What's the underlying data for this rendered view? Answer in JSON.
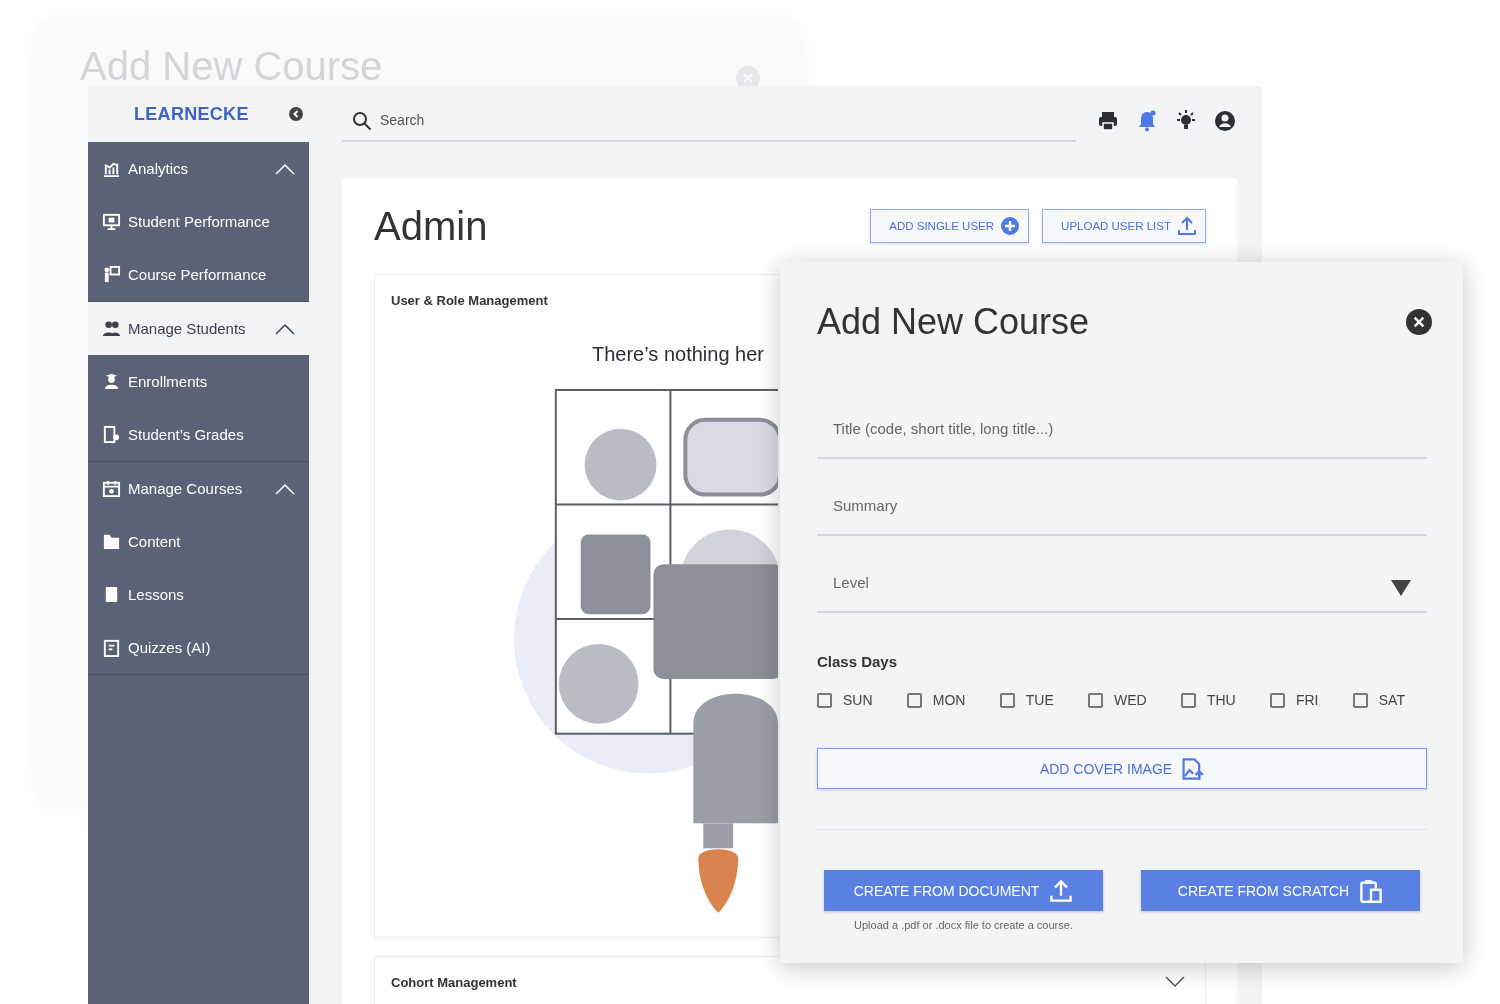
{
  "background_window": {
    "title": "Add New Course"
  },
  "logo": {
    "text": "LEARNECKE"
  },
  "search": {
    "placeholder": "Search"
  },
  "toolbar_icons": [
    {
      "kind": "print",
      "selected": false
    },
    {
      "kind": "bell",
      "selected": true
    },
    {
      "kind": "sun",
      "selected": false
    },
    {
      "kind": "account",
      "selected": false
    }
  ],
  "sidebar": {
    "sections": [
      {
        "label": "Analytics",
        "kind": "chart",
        "selected": false,
        "expanded": true,
        "items": [
          {
            "label": "Student Performance",
            "kind": "monitor"
          },
          {
            "label": "Course Performance",
            "kind": "presenter"
          }
        ]
      },
      {
        "label": "Manage Students",
        "kind": "people",
        "selected": true,
        "expanded": true,
        "items": [
          {
            "label": "Enrollments",
            "kind": "student"
          },
          {
            "label": "Student’s Grades",
            "kind": "grades"
          }
        ]
      },
      {
        "label": "Manage Courses",
        "kind": "calendar",
        "selected": false,
        "expanded": true,
        "items": [
          {
            "label": "Content",
            "kind": "folder"
          },
          {
            "label": "Lessons",
            "kind": "book"
          },
          {
            "label": "Quizzes (AI)",
            "kind": "clipboard"
          }
        ]
      }
    ]
  },
  "admin": {
    "title": "Admin",
    "buttons": [
      {
        "label": "ADD SINGLE USER",
        "kind": "add"
      },
      {
        "label": "UPLOAD USER LIST",
        "kind": "upload"
      }
    ],
    "panels": [
      {
        "title": "User & Role Management",
        "expanded": true,
        "message": "There’s nothing her"
      },
      {
        "title": "Cohort Management",
        "expanded": false
      }
    ]
  },
  "modal": {
    "title": "Add New Course",
    "fields": [
      {
        "placeholder": "Title (code, short title, long title...)",
        "kind": "text"
      },
      {
        "placeholder": "Summary",
        "kind": "text"
      },
      {
        "placeholder": "Level",
        "kind": "select"
      }
    ],
    "class_days_label": "Class Days",
    "days": [
      {
        "label": "SUN",
        "checked": false
      },
      {
        "label": "MON",
        "checked": false
      },
      {
        "label": "TUE",
        "checked": false
      },
      {
        "label": "WED",
        "checked": false
      },
      {
        "label": "THU",
        "checked": false
      },
      {
        "label": "FRI",
        "checked": false
      },
      {
        "label": "SAT",
        "checked": false
      }
    ],
    "cover_button": "ADD COVER IMAGE",
    "actions": [
      {
        "label": "CREATE FROM DOCUMENT",
        "kind": "document"
      },
      {
        "label": "CREATE FROM SCRATCH",
        "kind": "scratch"
      }
    ],
    "helper": "Upload a .pdf or .docx file to create a course."
  }
}
